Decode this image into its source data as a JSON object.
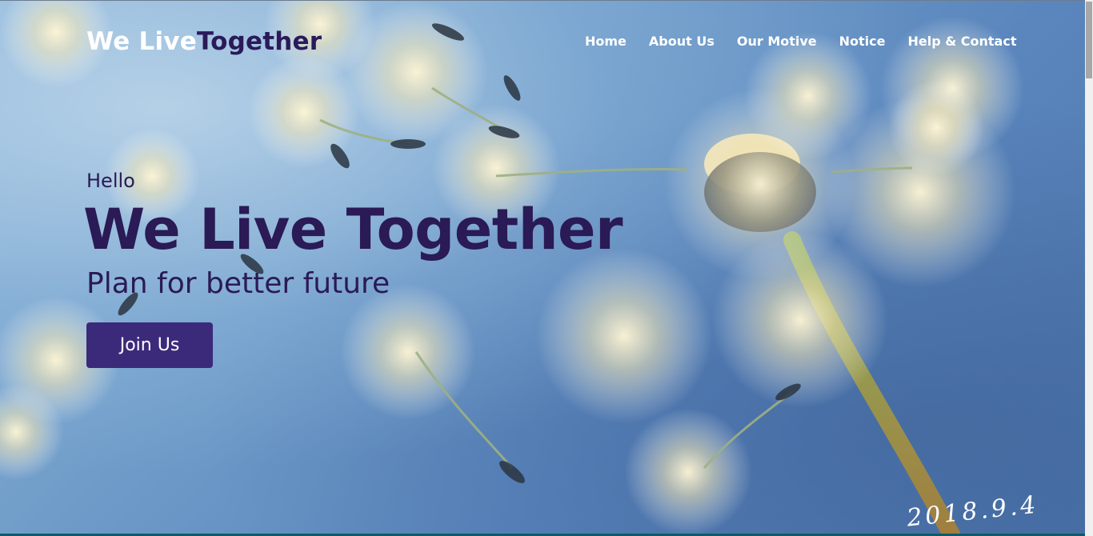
{
  "header": {
    "brand_part1": "We Live",
    "brand_part2": "Together",
    "nav": [
      "Home",
      "About Us",
      "Our Motive",
      "Notice",
      "Help & Contact"
    ]
  },
  "hero": {
    "greeting": "Hello",
    "title": "We Live Together",
    "subtitle": "Plan for better future",
    "cta_label": "Join Us",
    "signature": "2018.9.4"
  },
  "colors": {
    "brand_dark": "#2a1a55",
    "button": "#3b2a7a",
    "sky": "#6f9cc9"
  },
  "background_image": "dandelion-seeds-on-blue-sky"
}
